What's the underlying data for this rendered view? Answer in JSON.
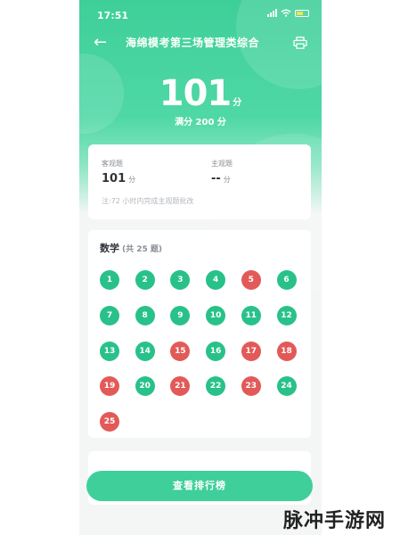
{
  "status_bar": {
    "time": "17:51"
  },
  "nav": {
    "title": "海绵模考第三场管理类综合",
    "back_icon": "back-arrow-icon",
    "print_icon": "printer-icon"
  },
  "score": {
    "value": "101",
    "unit": "分",
    "total": "满分 200 分"
  },
  "summary": {
    "objective_label": "客观题",
    "objective_value": "101",
    "objective_unit": "分",
    "subjective_label": "主观题",
    "subjective_value": "--",
    "subjective_unit": "分",
    "note": "注:72 小时内完成主观题批改"
  },
  "section": {
    "title": "数学",
    "count": "(共 25 题)",
    "questions": [
      {
        "n": "1",
        "status": "correct"
      },
      {
        "n": "2",
        "status": "correct"
      },
      {
        "n": "3",
        "status": "correct"
      },
      {
        "n": "4",
        "status": "correct"
      },
      {
        "n": "5",
        "status": "wrong"
      },
      {
        "n": "6",
        "status": "correct"
      },
      {
        "n": "7",
        "status": "correct"
      },
      {
        "n": "8",
        "status": "correct"
      },
      {
        "n": "9",
        "status": "correct"
      },
      {
        "n": "10",
        "status": "correct"
      },
      {
        "n": "11",
        "status": "correct"
      },
      {
        "n": "12",
        "status": "correct"
      },
      {
        "n": "13",
        "status": "correct"
      },
      {
        "n": "14",
        "status": "correct"
      },
      {
        "n": "15",
        "status": "wrong"
      },
      {
        "n": "16",
        "status": "correct"
      },
      {
        "n": "17",
        "status": "wrong"
      },
      {
        "n": "18",
        "status": "wrong"
      },
      {
        "n": "19",
        "status": "wrong"
      },
      {
        "n": "20",
        "status": "correct"
      },
      {
        "n": "21",
        "status": "wrong"
      },
      {
        "n": "22",
        "status": "correct"
      },
      {
        "n": "23",
        "status": "wrong"
      },
      {
        "n": "24",
        "status": "correct"
      },
      {
        "n": "25",
        "status": "wrong"
      }
    ]
  },
  "actions": {
    "rank_label": "查看排行榜"
  },
  "colors": {
    "brand_green": "#3ecf99",
    "correct": "#29c18a",
    "wrong": "#e25a58"
  },
  "watermark": "脉冲手游网"
}
